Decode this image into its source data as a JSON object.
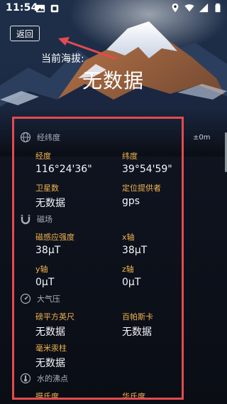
{
  "status_bar": {
    "time": "11:54",
    "left_icons": [
      "image-icon",
      "notification-icon"
    ],
    "right_icons": [
      "location-icon",
      "wifi-icon",
      "cellular-icon",
      "battery-icon"
    ]
  },
  "header": {
    "back_label": "返回",
    "altitude_label": "当前海拔:",
    "altitude_value": "无数据",
    "tolerance": "±0m"
  },
  "sections": [
    {
      "title": "经纬度",
      "icon": "globe-icon",
      "fields": [
        {
          "label": "经度",
          "value": "116°24'36\""
        },
        {
          "label": "纬度",
          "value": "39°54'59\""
        },
        {
          "label": "卫星数",
          "value": "无数据"
        },
        {
          "label": "定位提供者",
          "value": "gps"
        }
      ]
    },
    {
      "title": "磁场",
      "icon": "magnet-icon",
      "fields": [
        {
          "label": "磁感应强度",
          "value": "38μT"
        },
        {
          "label": "x轴",
          "value": "38μT"
        },
        {
          "label": "y轴",
          "value": "0μT"
        },
        {
          "label": "z轴",
          "value": "0μT"
        }
      ]
    },
    {
      "title": "大气压",
      "icon": "gauge-icon",
      "fields": [
        {
          "label": "磅平方英尺",
          "value": "无数据"
        },
        {
          "label": "百帕斯卡",
          "value": "无数据"
        },
        {
          "label": "毫米汞柱",
          "value": "无数据"
        }
      ]
    },
    {
      "title": "水的沸点",
      "icon": "thermometer-icon",
      "fields": [
        {
          "label": "摄氏度",
          "value": ""
        },
        {
          "label": "华氏度",
          "value": ""
        }
      ]
    }
  ],
  "colors": {
    "accent_label": "#f0b34e",
    "highlight_border": "#e44a4f"
  }
}
